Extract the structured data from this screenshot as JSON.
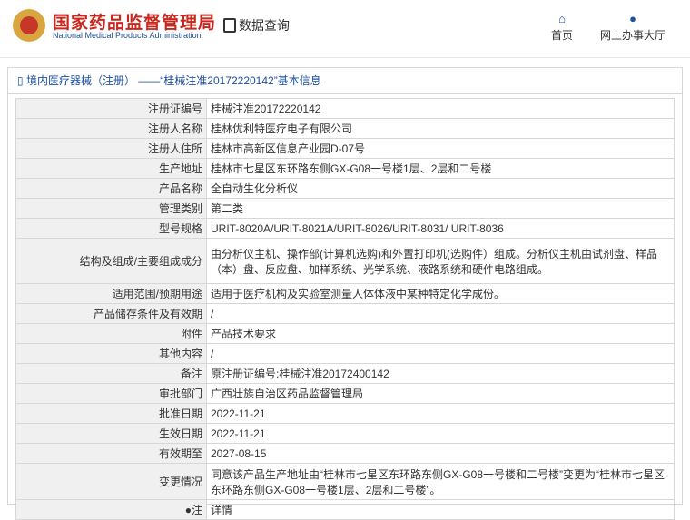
{
  "header": {
    "brand_cn": "国家药品监督管理局",
    "brand_en": "National Medical Products Administration",
    "query_label": "数据查询",
    "nav_home": "首页",
    "nav_hall": "网上办事大厅"
  },
  "section": {
    "title": "境内医疗器械（注册） ——“桂械注准20172220142”基本信息"
  },
  "rows": [
    {
      "k": "注册证编号",
      "v": "桂械注准20172220142"
    },
    {
      "k": "注册人名称",
      "v": "桂林优利特医疗电子有限公司"
    },
    {
      "k": "注册人住所",
      "v": "桂林市高新区信息产业园D-07号"
    },
    {
      "k": "生产地址",
      "v": "桂林市七星区东环路东侧GX-G08一号楼1层、2层和二号楼"
    },
    {
      "k": "产品名称",
      "v": "全自动生化分析仪"
    },
    {
      "k": "管理类别",
      "v": "第二类"
    },
    {
      "k": "型号规格",
      "v": "URIT-8020A/URIT-8021A/URIT-8026/URIT-8031/ URIT-8036"
    },
    {
      "k": "结构及组成/主要组成成分",
      "v": "由分析仪主机、操作部(计算机选购)和外置打印机(选购件）组成。分析仪主机由试剂盘、样品（本）盘、反应盘、加样系统、光学系统、液路系统和硬件电路组成。"
    },
    {
      "k": "适用范围/预期用途",
      "v": "适用于医疗机构及实验室测量人体体液中某种特定化学成份。"
    },
    {
      "k": "产品储存条件及有效期",
      "v": "/"
    },
    {
      "k": "附件",
      "v": "产品技术要求"
    },
    {
      "k": "其他内容",
      "v": "/"
    },
    {
      "k": "备注",
      "v": "原注册证编号:桂械注准20172400142"
    },
    {
      "k": "审批部门",
      "v": "广西壮族自治区药品监督管理局"
    },
    {
      "k": "批准日期",
      "v": "2022-11-21"
    },
    {
      "k": "生效日期",
      "v": "2022-11-21"
    },
    {
      "k": "有效期至",
      "v": "2027-08-15"
    },
    {
      "k": "变更情况",
      "v": "同意该产品生产地址由“桂林市七星区东环路东侧GX-G08一号楼和二号楼”变更为“桂林市七星区东环路东侧GX-G08一号楼1层、2层和二号楼”。"
    },
    {
      "k": "注",
      "v": "详情"
    }
  ]
}
